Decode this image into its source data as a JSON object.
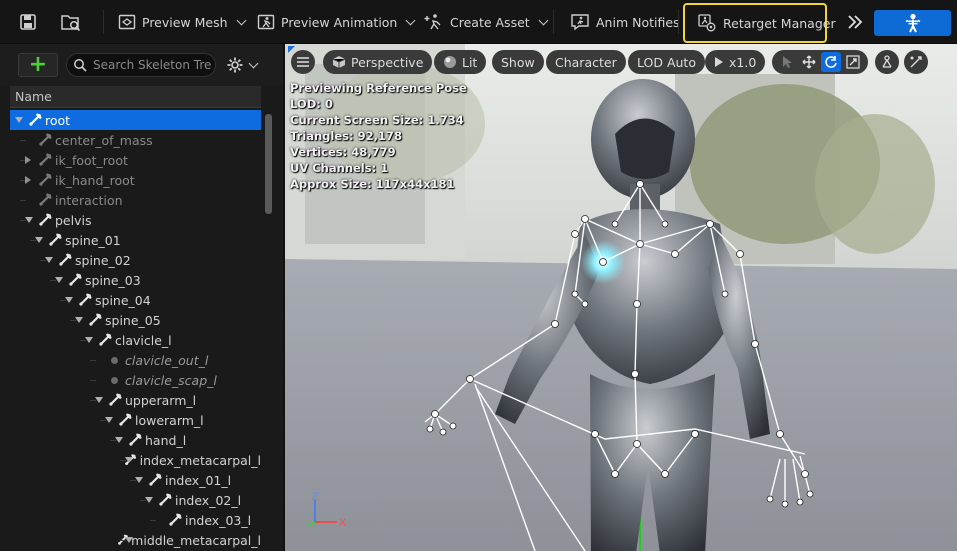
{
  "toolbar": {
    "save_icon": "save-icon",
    "browse_icon": "browse-asset-icon",
    "preview_mesh": "Preview Mesh",
    "preview_animation": "Preview Animation",
    "create_asset": "Create Asset",
    "anim_notifies": "Anim Notifies",
    "retarget_manager": "Retarget Manager",
    "highlight_color": "#f0d43a",
    "accent_color": "#0e6bd6"
  },
  "skeleton_tree": {
    "search_placeholder": "Search Skeleton Tree",
    "column_header": "Name",
    "rows": [
      {
        "label": "root"
      },
      {
        "label": "center_of_mass"
      },
      {
        "label": "ik_foot_root"
      },
      {
        "label": "ik_hand_root"
      },
      {
        "label": "interaction"
      },
      {
        "label": "pelvis"
      },
      {
        "label": "spine_01"
      },
      {
        "label": "spine_02"
      },
      {
        "label": "spine_03"
      },
      {
        "label": "spine_04"
      },
      {
        "label": "spine_05"
      },
      {
        "label": "clavicle_l"
      },
      {
        "label": "clavicle_out_l"
      },
      {
        "label": "clavicle_scap_l"
      },
      {
        "label": "upperarm_l"
      },
      {
        "label": "lowerarm_l"
      },
      {
        "label": "hand_l"
      },
      {
        "label": "index_metacarpal_l"
      },
      {
        "label": "index_01_l"
      },
      {
        "label": "index_02_l"
      },
      {
        "label": "index_03_l"
      },
      {
        "label": "middle_metacarpal_l"
      }
    ]
  },
  "viewport": {
    "perspective": "Perspective",
    "lit": "Lit",
    "show": "Show",
    "character": "Character",
    "lod": "LOD Auto",
    "play_rate": "x1.0",
    "stats": {
      "line1": "Previewing Reference Pose",
      "line2": "LOD: 0",
      "line3": "Current Screen Size: 1.734",
      "line4": "Triangles: 92,178",
      "line5": "Vertices: 48,779",
      "line6": "UV Channels: 1",
      "line7": "Approx Size: 117x44x181"
    },
    "axis": {
      "z": "Z",
      "x": "X"
    }
  }
}
